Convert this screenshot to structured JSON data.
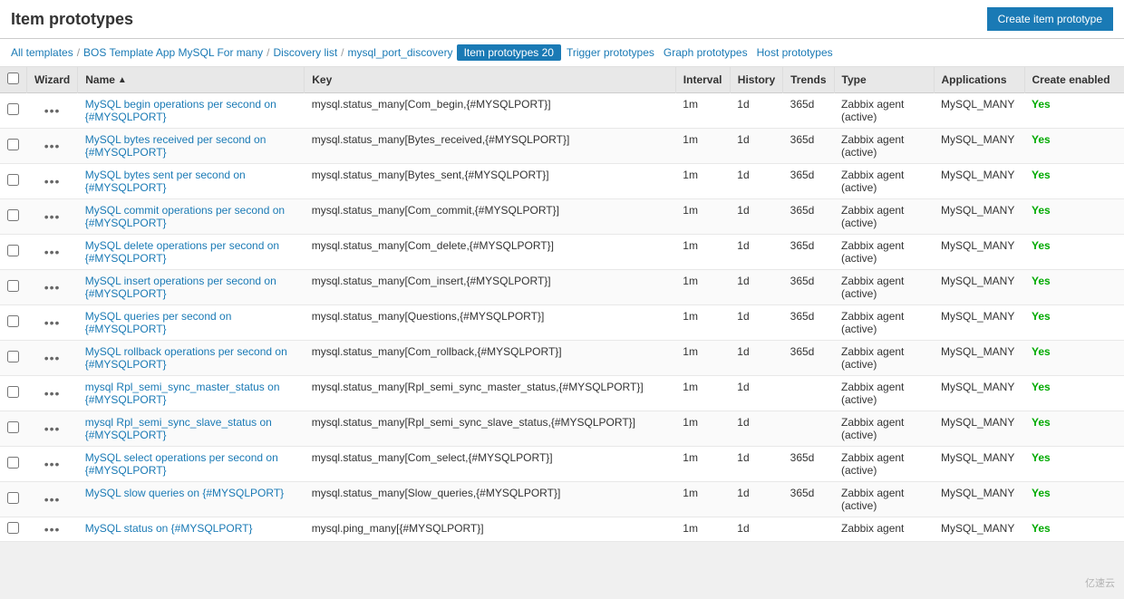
{
  "header": {
    "title": "Item prototypes",
    "create_button_label": "Create item prototype"
  },
  "breadcrumb": {
    "all_templates": "All templates",
    "separator1": "/",
    "template_name": "BOS Template App MySQL For many",
    "separator2": "/",
    "discovery_list": "Discovery list",
    "separator3": "/",
    "discovery_rule": "mysql_port_discovery",
    "separator4": ""
  },
  "tabs": [
    {
      "label": "Item prototypes 20",
      "active": true
    },
    {
      "label": "Trigger prototypes",
      "active": false
    },
    {
      "label": "Graph prototypes",
      "active": false
    },
    {
      "label": "Host prototypes",
      "active": false
    }
  ],
  "table": {
    "columns": {
      "wizard": "Wizard",
      "name": "Name",
      "name_sort": "▲",
      "key": "Key",
      "interval": "Interval",
      "history": "History",
      "trends": "Trends",
      "type": "Type",
      "applications": "Applications",
      "create_enabled": "Create enabled"
    },
    "rows": [
      {
        "name": "MySQL begin operations per second on {#MYSQLPORT}",
        "key": "mysql.status_many[Com_begin,{#MYSQLPORT}]",
        "interval": "1m",
        "history": "1d",
        "trends": "365d",
        "type": "Zabbix agent (active)",
        "applications": "MySQL_MANY",
        "create_enabled": "Yes"
      },
      {
        "name": "MySQL bytes received per second on {#MYSQLPORT}",
        "key": "mysql.status_many[Bytes_received,{#MYSQLPORT}]",
        "interval": "1m",
        "history": "1d",
        "trends": "365d",
        "type": "Zabbix agent (active)",
        "applications": "MySQL_MANY",
        "create_enabled": "Yes"
      },
      {
        "name": "MySQL bytes sent per second on {#MYSQLPORT}",
        "key": "mysql.status_many[Bytes_sent,{#MYSQLPORT}]",
        "interval": "1m",
        "history": "1d",
        "trends": "365d",
        "type": "Zabbix agent (active)",
        "applications": "MySQL_MANY",
        "create_enabled": "Yes"
      },
      {
        "name": "MySQL commit operations per second on {#MYSQLPORT}",
        "key": "mysql.status_many[Com_commit,{#MYSQLPORT}]",
        "interval": "1m",
        "history": "1d",
        "trends": "365d",
        "type": "Zabbix agent (active)",
        "applications": "MySQL_MANY",
        "create_enabled": "Yes"
      },
      {
        "name": "MySQL delete operations per second on {#MYSQLPORT}",
        "key": "mysql.status_many[Com_delete,{#MYSQLPORT}]",
        "interval": "1m",
        "history": "1d",
        "trends": "365d",
        "type": "Zabbix agent (active)",
        "applications": "MySQL_MANY",
        "create_enabled": "Yes"
      },
      {
        "name": "MySQL insert operations per second on {#MYSQLPORT}",
        "key": "mysql.status_many[Com_insert,{#MYSQLPORT}]",
        "interval": "1m",
        "history": "1d",
        "trends": "365d",
        "type": "Zabbix agent (active)",
        "applications": "MySQL_MANY",
        "create_enabled": "Yes"
      },
      {
        "name": "MySQL queries per second on {#MYSQLPORT}",
        "key": "mysql.status_many[Questions,{#MYSQLPORT}]",
        "interval": "1m",
        "history": "1d",
        "trends": "365d",
        "type": "Zabbix agent (active)",
        "applications": "MySQL_MANY",
        "create_enabled": "Yes"
      },
      {
        "name": "MySQL rollback operations per second on {#MYSQLPORT}",
        "key": "mysql.status_many[Com_rollback,{#MYSQLPORT}]",
        "interval": "1m",
        "history": "1d",
        "trends": "365d",
        "type": "Zabbix agent (active)",
        "applications": "MySQL_MANY",
        "create_enabled": "Yes"
      },
      {
        "name": "mysql Rpl_semi_sync_master_status on {#MYSQLPORT}",
        "key": "mysql.status_many[Rpl_semi_sync_master_status,{#MYSQLPORT}]",
        "interval": "1m",
        "history": "1d",
        "trends": "",
        "type": "Zabbix agent (active)",
        "applications": "MySQL_MANY",
        "create_enabled": "Yes"
      },
      {
        "name": "mysql Rpl_semi_sync_slave_status on {#MYSQLPORT}",
        "key": "mysql.status_many[Rpl_semi_sync_slave_status,{#MYSQLPORT}]",
        "interval": "1m",
        "history": "1d",
        "trends": "",
        "type": "Zabbix agent (active)",
        "applications": "MySQL_MANY",
        "create_enabled": "Yes"
      },
      {
        "name": "MySQL select operations per second on {#MYSQLPORT}",
        "key": "mysql.status_many[Com_select,{#MYSQLPORT}]",
        "interval": "1m",
        "history": "1d",
        "trends": "365d",
        "type": "Zabbix agent (active)",
        "applications": "MySQL_MANY",
        "create_enabled": "Yes"
      },
      {
        "name": "MySQL slow queries on {#MYSQLPORT}",
        "key": "mysql.status_many[Slow_queries,{#MYSQLPORT}]",
        "interval": "1m",
        "history": "1d",
        "trends": "365d",
        "type": "Zabbix agent (active)",
        "applications": "MySQL_MANY",
        "create_enabled": "Yes"
      },
      {
        "name": "MySQL status on {#MYSQLPORT}",
        "key": "mysql.ping_many[{#MYSQLPORT}]",
        "interval": "1m",
        "history": "1d",
        "trends": "",
        "type": "Zabbix agent",
        "applications": "MySQL_MANY",
        "create_enabled": "Yes"
      }
    ]
  },
  "watermark": "亿速云"
}
